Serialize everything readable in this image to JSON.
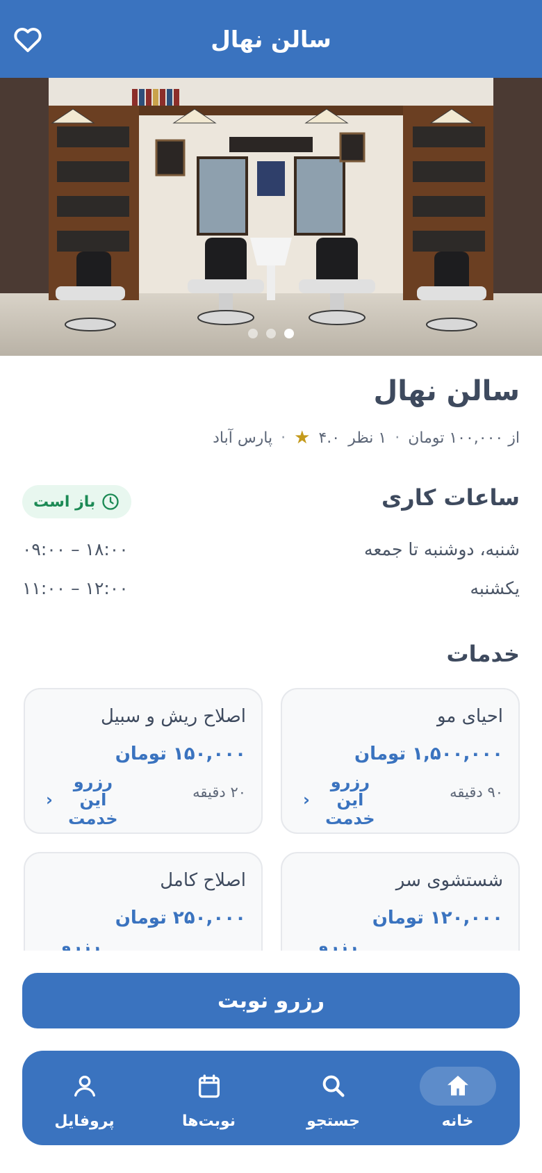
{
  "app": {
    "title": "سالن نهال"
  },
  "hero": {
    "image_alt": "barbershop interior",
    "slides": 3,
    "active_slide": 3
  },
  "salon": {
    "name": "سالن نهال",
    "location": "پارس آباد",
    "rating": "۴.۰",
    "reviews": "۱ نظر",
    "price_from": "از ۱۰۰,۰۰۰ تومان",
    "separator": "·"
  },
  "hours": {
    "title": "ساعات کاری",
    "status": "باز است",
    "rows": [
      {
        "days": "شنبه، دوشنبه تا جمعه",
        "time": "۰۹:۰۰ – ۱۸:۰۰"
      },
      {
        "days": "یکشنبه",
        "time": "۱۱:۰۰ – ۱۲:۰۰"
      }
    ]
  },
  "services": {
    "title": "خدمات",
    "book_label": "رزرو این خدمت",
    "items": [
      {
        "name": "احیای مو",
        "price": "۱,۵۰۰,۰۰۰ تومان",
        "duration": "۹۰ دقیقه"
      },
      {
        "name": "اصلاح ریش و سبیل",
        "price": "۱۵۰,۰۰۰ تومان",
        "duration": "۲۰ دقیقه"
      },
      {
        "name": "شستشوی سر",
        "price": "۱۲۰,۰۰۰ تومان",
        "duration": ""
      },
      {
        "name": "اصلاح کامل",
        "price": "۲۵۰,۰۰۰ تومان",
        "duration": ""
      }
    ]
  },
  "cta": {
    "label": "رزرو نوبت"
  },
  "nav": {
    "items": [
      {
        "label": "خانه",
        "icon": "home-icon",
        "active": true
      },
      {
        "label": "جستجو",
        "icon": "search-icon",
        "active": false
      },
      {
        "label": "نوبت‌ها",
        "icon": "calendar-icon",
        "active": false
      },
      {
        "label": "پروفایل",
        "icon": "user-icon",
        "active": false
      }
    ]
  },
  "colors": {
    "primary": "#3a73bf",
    "open_bg": "#e8f7ef",
    "open_text": "#1c8a55",
    "star": "#c49a1b"
  }
}
